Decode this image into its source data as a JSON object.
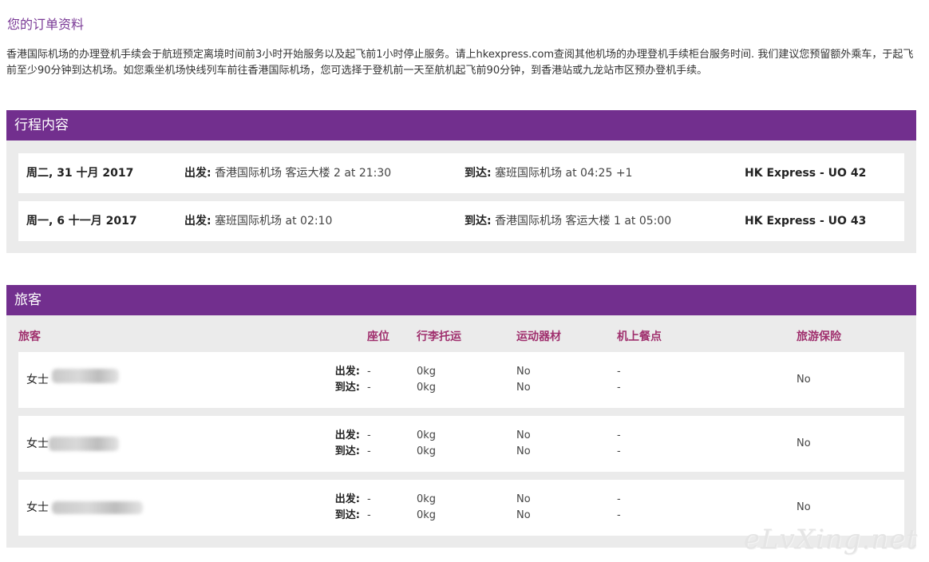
{
  "page": {
    "title": "您的订单资料",
    "intro": "香港国际机场的办理登机手续会于航班预定离境时间前3小时开始服务以及起飞前1小时停止服务。请上hkexpress.com查阅其他机场的办理登机手续柜台服务时间. 我们建议您预留额外乘车，于起飞前至少90分钟到达机场。如您乘坐机场快线列车前往香港国际机场，您可选择于登机前一天至航机起飞前90分钟，到香港站或九龙站市区预办登机手续。"
  },
  "itinerary": {
    "header": "行程内容",
    "flights": [
      {
        "date": "周二, 31 十月 2017",
        "depart_label": "出发:",
        "depart_value": "香港国际机场 客运大楼 2 at 21:30",
        "arrive_label": "到达:",
        "arrive_value": "塞班国际机场 at 04:25 +1",
        "flight": "HK Express - UO 42"
      },
      {
        "date": "周一, 6 十一月 2017",
        "depart_label": "出发:",
        "depart_value": "塞班国际机场 at 02:10",
        "arrive_label": "到达:",
        "arrive_value": "香港国际机场 客运大楼 1 at 05:00",
        "flight": "HK Express - UO 43"
      }
    ]
  },
  "passengers": {
    "header": "旅客",
    "columns": {
      "passenger": "旅客",
      "seat": "座位",
      "baggage": "行李托运",
      "sports": "运动器材",
      "meal": "机上餐点",
      "insurance": "旅游保险"
    },
    "depart_label": "出发:",
    "arrive_label": "到达:",
    "rows": [
      {
        "name": "女士",
        "seat_out": "-",
        "seat_in": "-",
        "bag_out": "0kg",
        "bag_in": "0kg",
        "sport_out": "No",
        "sport_in": "No",
        "meal_out": "-",
        "meal_in": "-",
        "insurance": "No"
      },
      {
        "name": "女士",
        "seat_out": "-",
        "seat_in": "-",
        "bag_out": "0kg",
        "bag_in": "0kg",
        "sport_out": "No",
        "sport_in": "No",
        "meal_out": "-",
        "meal_in": "-",
        "insurance": "No"
      },
      {
        "name": "女士",
        "seat_out": "-",
        "seat_in": "-",
        "bag_out": "0kg",
        "bag_in": "0kg",
        "sport_out": "No",
        "sport_in": "No",
        "meal_out": "-",
        "meal_in": "-",
        "insurance": "No"
      }
    ]
  },
  "watermark": "eLvXing.net",
  "colors": {
    "header_bg": "#722f8e",
    "column_header": "#a0306e",
    "panel_bg": "#ebebeb"
  }
}
